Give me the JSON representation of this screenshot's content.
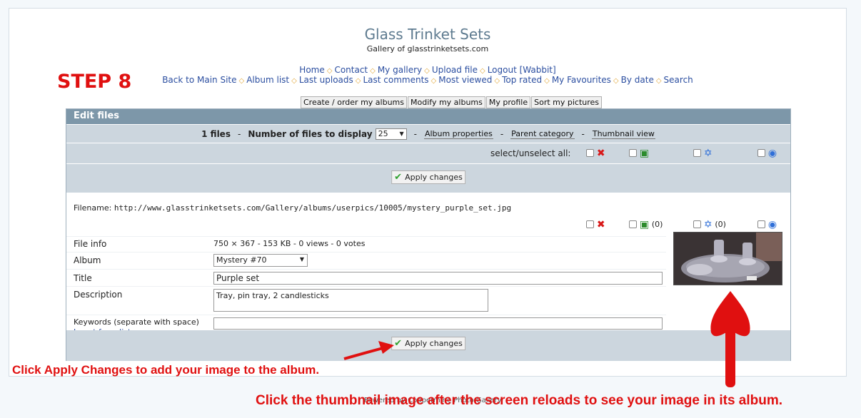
{
  "site": {
    "title": "Glass Trinket Sets",
    "subtitle": "Gallery of glasstrinketsets.com"
  },
  "nav1": [
    "Home",
    "Contact",
    "My gallery",
    "Upload file",
    "Logout [Wabbit]"
  ],
  "nav2": [
    "Back to Main Site",
    "Album list",
    "Last uploads",
    "Last comments",
    "Most viewed",
    "Top rated",
    "My Favourites",
    "By date",
    "Search"
  ],
  "tabs": [
    "Create / order my albums",
    "Modify my albums",
    "My profile",
    "Sort my pictures"
  ],
  "panel": {
    "title": "Edit files",
    "files_count": "1 files",
    "files_to_display_label": "Number of files to display",
    "files_to_display_value": "25",
    "links": [
      "Album properties",
      "Parent category",
      "Thumbnail view"
    ],
    "select_all_label": "select/unselect all:",
    "apply_label": "Apply changes"
  },
  "file": {
    "filename_label": "Filename:",
    "filename": "http://www.glasstrinketsets.com/Gallery/albums/userpics/10005/mystery_purple_set.jpg",
    "count_a": "(0)",
    "count_b": "(0)",
    "info_label": "File info",
    "info_value": "750 × 367 - 153 KB - 0 views - 0 votes",
    "album_label": "Album",
    "album_value": "Mystery #70",
    "title_label": "Title",
    "title_value": "Purple set",
    "description_label": "Description",
    "description_value": "Tray, pin tray, 2 candlesticks",
    "keywords_label": "Keywords (separate with space)",
    "insert_link": "Insert from list",
    "keywords_value": ""
  },
  "annotations": {
    "step": "STEP 8",
    "note1": "Click Apply Changes to add your image to the album.",
    "note2": "Click the thumbnail image after the screen reloads to see your image in its album.",
    "footer": "Powered by Coppermine Photo Gallery",
    "color": "#e01010"
  }
}
